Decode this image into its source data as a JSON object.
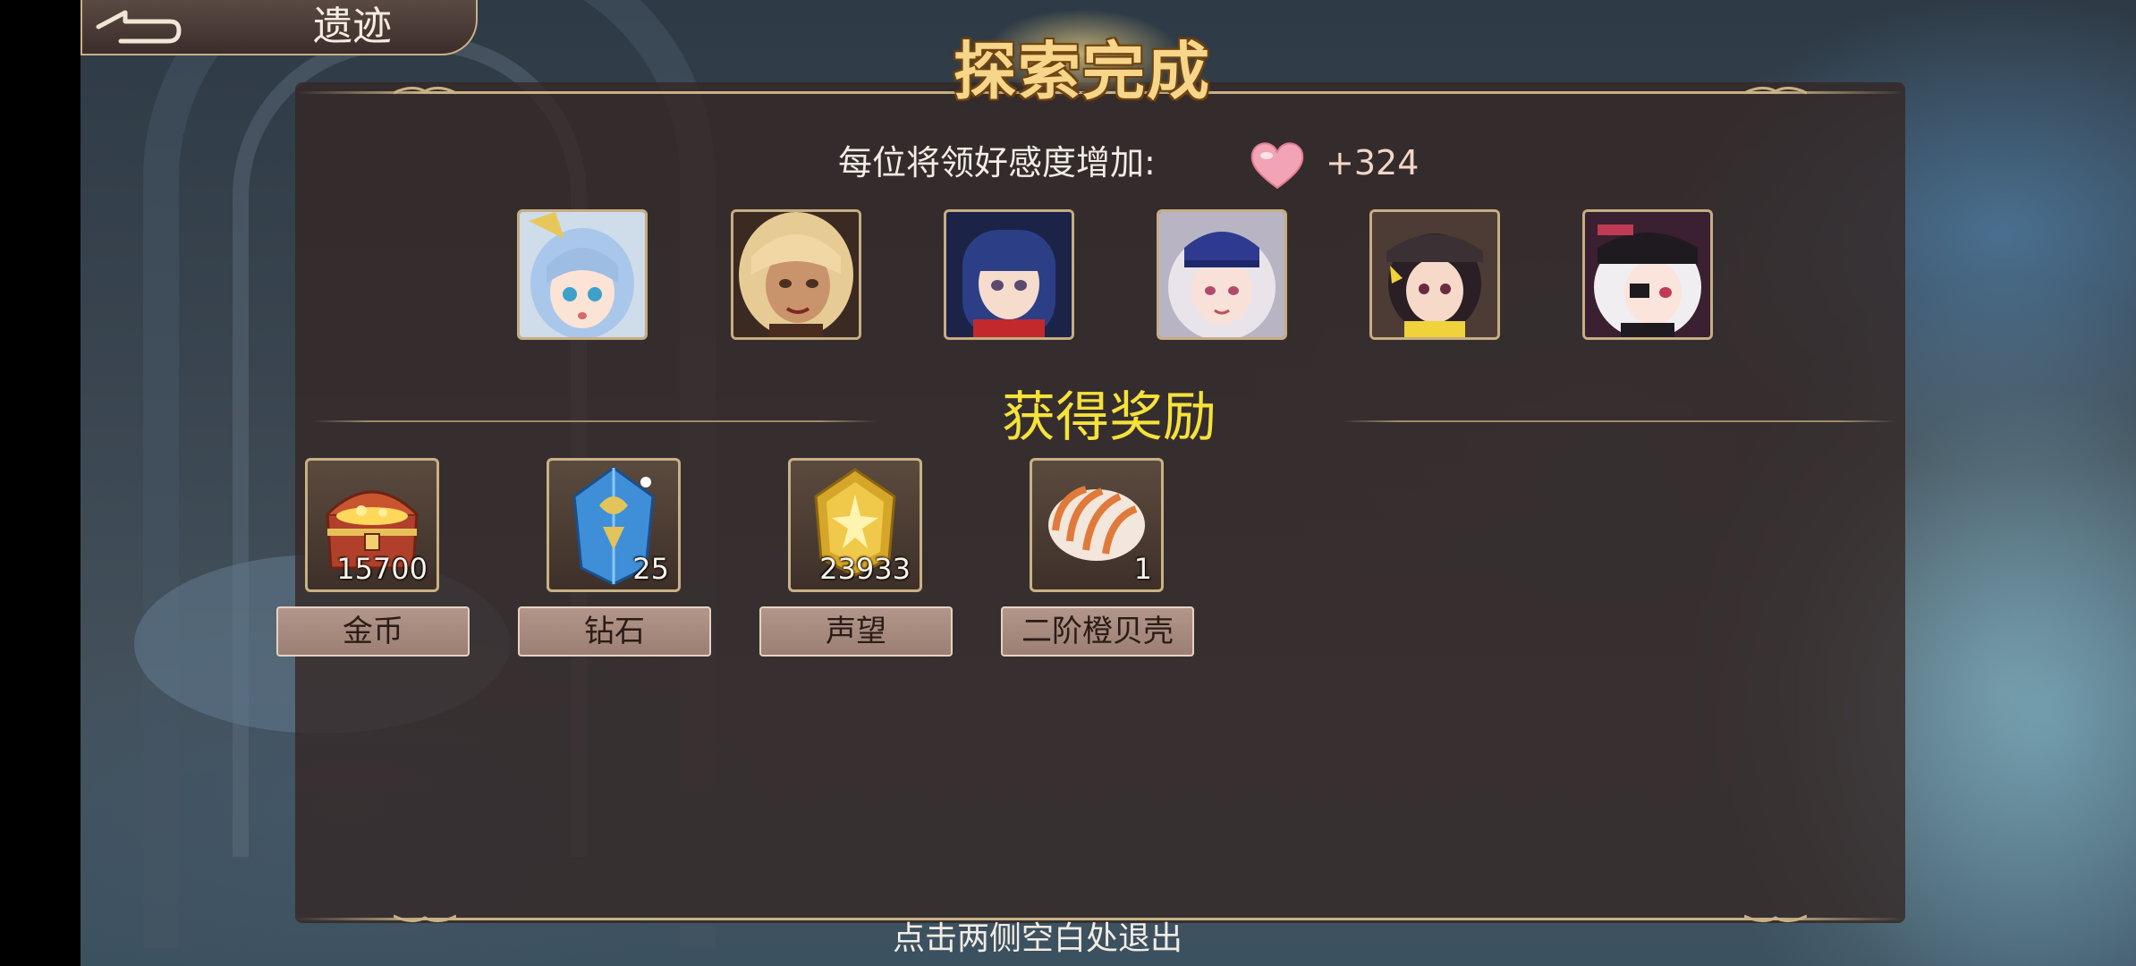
{
  "header": {
    "title": "遗迹",
    "back_icon": "back-arrow-icon"
  },
  "banner": {
    "text": "探索完成"
  },
  "affection": {
    "label": "每位将领好感度增加:",
    "icon": "heart-icon",
    "value": "+324"
  },
  "characters": [
    {
      "name": "character-1",
      "hair": "#a9c7ea",
      "accent": "#e8c75a"
    },
    {
      "name": "character-2",
      "hair": "#e6cc94",
      "accent": "#4a2d1f"
    },
    {
      "name": "character-3",
      "hair": "#2c3f86",
      "accent": "#c2292d"
    },
    {
      "name": "character-4",
      "hair": "#e9e4ea",
      "accent": "#2d3a8f"
    },
    {
      "name": "character-5",
      "hair": "#2a1f24",
      "accent": "#f0d23a"
    },
    {
      "name": "character-6",
      "hair": "#f1eef2",
      "accent": "#c13a54"
    }
  ],
  "rewards": {
    "title": "获得奖励",
    "items": [
      {
        "name": "金币",
        "count": "15700",
        "icon": "treasure-chest-icon"
      },
      {
        "name": "钻石",
        "count": "25",
        "icon": "diamond-crystal-icon"
      },
      {
        "name": "声望",
        "count": "23933",
        "icon": "prestige-badge-icon"
      },
      {
        "name": "二阶橙贝壳",
        "count": "1",
        "icon": "orange-shell-icon"
      }
    ]
  },
  "footer": {
    "hint": "点击两侧空白处退出"
  }
}
